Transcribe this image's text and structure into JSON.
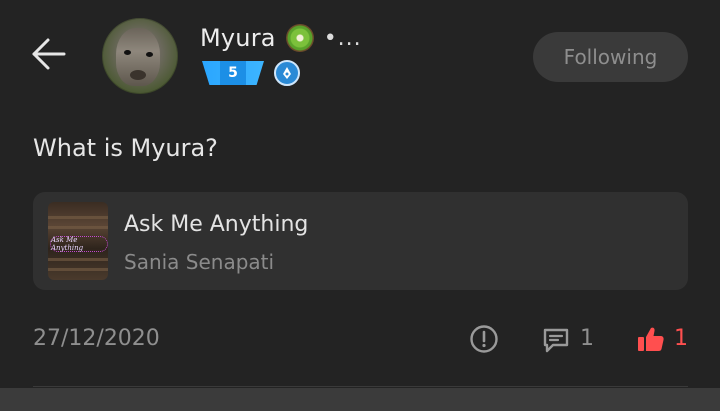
{
  "header": {
    "username": "Myura",
    "more_indicator": "•...",
    "level": "5",
    "follow_label": "Following"
  },
  "post": {
    "question": "What is Myura?",
    "card": {
      "title": "Ask Me Anything",
      "subtitle": "Sania Senapati",
      "thumbnail_text": "Ask Me Anything"
    },
    "date": "27/12/2020",
    "comments": "1",
    "likes": "1"
  },
  "colors": {
    "like": "#ff4f4f",
    "level_badge": "#2aa6ff",
    "background": "#232323"
  },
  "icons": [
    "back-arrow-icon",
    "kiwi-emoji-icon",
    "level-badge-icon",
    "pen-badge-icon",
    "report-icon",
    "comment-icon",
    "thumbs-up-icon"
  ]
}
